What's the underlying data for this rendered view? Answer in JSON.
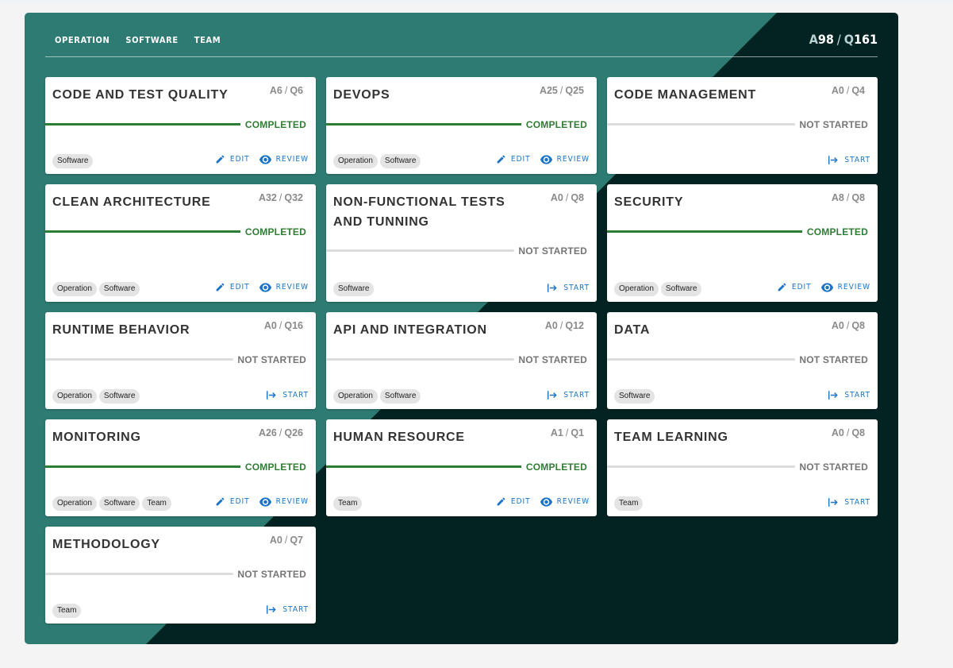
{
  "nav": [
    "OPERATION",
    "SOFTWARE",
    "TEAM"
  ],
  "totals": {
    "a_prefix": "A",
    "a_value": "98",
    "separator": "/",
    "q_prefix": "Q",
    "q_value": "161"
  },
  "labels": {
    "edit": "EDIT",
    "review": "REVIEW",
    "start": "START",
    "completed": "COMPLETED",
    "not_started": "NOT STARTED"
  },
  "colors": {
    "panel_light": "#2d7b72",
    "panel_dark": "#032322",
    "completed": "#2e7d32",
    "action": "#1a73c4"
  },
  "cards": [
    {
      "title": "CODE AND TEST QUALITY",
      "answered": "A6",
      "questions": "Q6",
      "status": "completed",
      "progress": 1,
      "tags": [
        "Software"
      ]
    },
    {
      "title": "DEVOPS",
      "answered": "A25",
      "questions": "Q25",
      "status": "completed",
      "progress": 1,
      "tags": [
        "Operation",
        "Software"
      ]
    },
    {
      "title": "CODE MANAGEMENT",
      "answered": "A0",
      "questions": "Q4",
      "status": "not_started",
      "progress": 0,
      "tags": []
    },
    {
      "title": "CLEAN ARCHITECTURE",
      "answered": "A32",
      "questions": "Q32",
      "status": "completed",
      "progress": 1,
      "tags": [
        "Operation",
        "Software"
      ]
    },
    {
      "title": "NON-FUNCTIONAL TESTS AND TUNNING",
      "answered": "A0",
      "questions": "Q8",
      "status": "not_started",
      "progress": 0,
      "tags": [
        "Software"
      ]
    },
    {
      "title": "SECURITY",
      "answered": "A8",
      "questions": "Q8",
      "status": "completed",
      "progress": 1,
      "tags": [
        "Operation",
        "Software"
      ]
    },
    {
      "title": "RUNTIME BEHAVIOR",
      "answered": "A0",
      "questions": "Q16",
      "status": "not_started",
      "progress": 0,
      "tags": [
        "Operation",
        "Software"
      ]
    },
    {
      "title": "API AND INTEGRATION",
      "answered": "A0",
      "questions": "Q12",
      "status": "not_started",
      "progress": 0,
      "tags": [
        "Operation",
        "Software"
      ]
    },
    {
      "title": "DATA",
      "answered": "A0",
      "questions": "Q8",
      "status": "not_started",
      "progress": 0,
      "tags": [
        "Software"
      ]
    },
    {
      "title": "MONITORING",
      "answered": "A26",
      "questions": "Q26",
      "status": "completed",
      "progress": 1,
      "tags": [
        "Operation",
        "Software",
        "Team"
      ]
    },
    {
      "title": "HUMAN RESOURCE",
      "answered": "A1",
      "questions": "Q1",
      "status": "completed",
      "progress": 1,
      "tags": [
        "Team"
      ]
    },
    {
      "title": "TEAM LEARNING",
      "answered": "A0",
      "questions": "Q8",
      "status": "not_started",
      "progress": 0,
      "tags": [
        "Team"
      ]
    },
    {
      "title": "METHODOLOGY",
      "answered": "A0",
      "questions": "Q7",
      "status": "not_started",
      "progress": 0,
      "tags": [
        "Team"
      ]
    }
  ]
}
